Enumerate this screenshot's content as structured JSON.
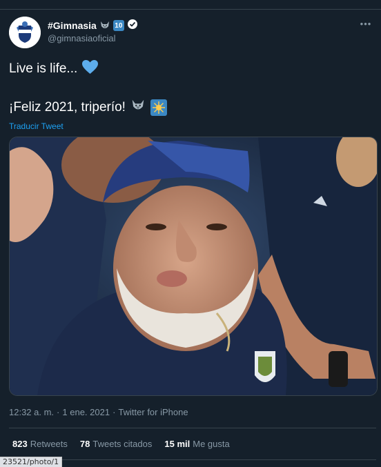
{
  "tweet": {
    "display_name": "#Gimnasia",
    "name_emoji": [
      "wolf-emoji",
      "ten-badge",
      "verified-badge"
    ],
    "ten_label": "10",
    "handle": "@gimnasiaoficial",
    "more_label": "•••",
    "line1": "Live is life...",
    "line2": "¡Feliz 2021, triperío!",
    "translate": "Traducir Tweet",
    "time": "12:32 a. m.",
    "dot": "·",
    "date": "1 ene. 2021",
    "source": "Twitter for iPhone",
    "retweets_count": "823",
    "retweets_label": "Retweets",
    "quotes_count": "78",
    "quotes_label": "Tweets citados",
    "likes_count": "15 mil",
    "likes_label": "Me gusta"
  },
  "status_bar_url": "23521/photo/1",
  "colors": {
    "background": "#15202b",
    "divider": "#38444d",
    "secondary_text": "#8899a6",
    "link": "#1da1f2",
    "heart": "#5dadec"
  }
}
